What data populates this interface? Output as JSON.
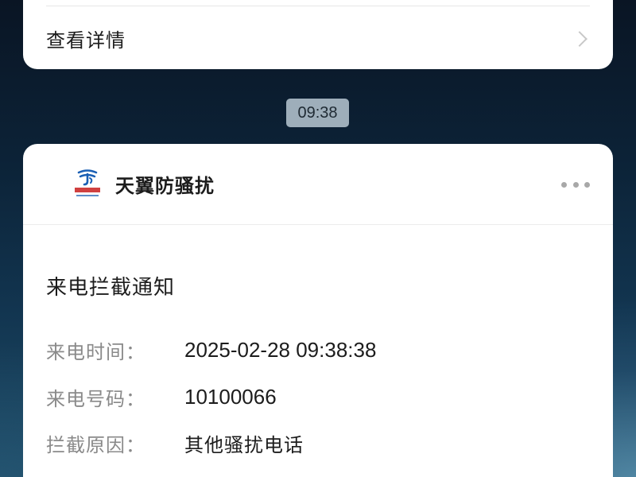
{
  "previous_card": {
    "details_label": "查看详情"
  },
  "timestamp": "09:38",
  "notification": {
    "app_name": "天翼防骚扰",
    "logo": "china-telecom-logo",
    "title": "来电拦截通知",
    "rows": [
      {
        "label": "来电时间：",
        "value": "2025-02-28 09:38:38"
      },
      {
        "label": "来电号码：",
        "value": "10100066"
      },
      {
        "label": "拦截原因：",
        "value": "其他骚扰电话"
      }
    ]
  },
  "colors": {
    "logo_blue": "#1a5fb4",
    "logo_text": "#c81e1e"
  }
}
